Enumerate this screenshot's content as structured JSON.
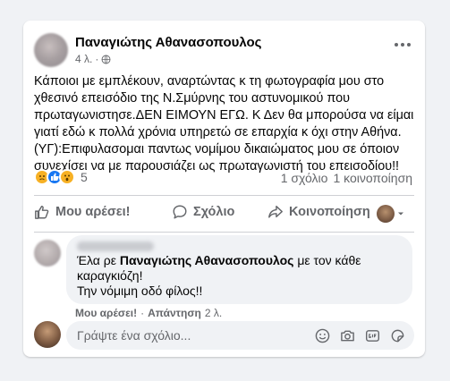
{
  "post": {
    "author": "Παναγιώτης Αθανασοπουλος",
    "time": "4 λ.",
    "privacy_icon": "globe-icon",
    "text": "Κάποιοι με εμπλέκουν, αναρτώντας κ τη φωτογραφία μου στο χθεσινό επεισόδιο της Ν.Σμύρνης του αστυνομικού που πρωταγωνιστησε.ΔΕΝ ΕΙΜΟΥΝ ΕΓΩ. Κ Δεν θα μπορούσα να είμαι γιατί εδώ κ πολλά χρόνια υπηρετώ σε επαρχία κ όχι στην Αθήνα.(ΥΓ):Επιφυλασομαι παντως νομίμου δικαιώματος μου σε όποιον συνεχίσει να με παρουσιάζει ως πρωταγωνιστή του επεισοδίου!!",
    "reaction_count": "5",
    "reactions": [
      "sad",
      "like",
      "wow"
    ],
    "comments_count": "1 σχόλιο",
    "shares_count": "1 κοινοποίηση"
  },
  "actions": {
    "like": "Μου αρέσει!",
    "comment": "Σχόλιο",
    "share": "Κοινοποίηση"
  },
  "comment": {
    "line1_prefix": "Έλα ρε ",
    "mention": "Παναγιώτης Αθανασοπουλος",
    "line1_suffix": " με τον κάθε καραγκιόζη!",
    "line2": "Την νόμιμη οδό φίλος!!",
    "like": "Μου αρέσει!",
    "sep": "·",
    "reply": "Απάντηση",
    "time": "2 λ."
  },
  "composer": {
    "placeholder": "Γράψτε ένα σχόλιο..."
  },
  "colors": {
    "accent": "#1877f2",
    "secondary_text": "#65676b",
    "background": "#f0f2f5"
  }
}
